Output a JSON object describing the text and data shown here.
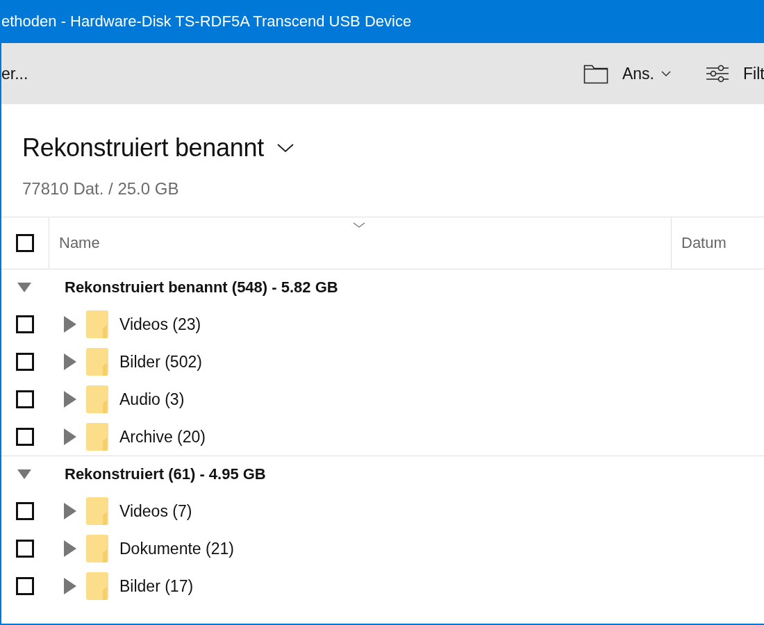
{
  "window": {
    "title": "ethoden - Hardware-Disk TS-RDF5A Transcend USB Device"
  },
  "toolbar": {
    "left_text": "er...",
    "view_button": "Ans.",
    "filter_button": "Filt"
  },
  "heading": {
    "title": "Rekonstruiert benannt",
    "summary": "77810 Dat. / 25.0 GB"
  },
  "table": {
    "select_all_checked": false,
    "columns": [
      "Name",
      "Datum"
    ],
    "groups": [
      {
        "label": "Rekonstruiert benannt (548) - 5.82 GB",
        "expanded": true,
        "rows": [
          {
            "name": "Videos (23)",
            "checked": false,
            "expanded": false
          },
          {
            "name": "Bilder (502)",
            "checked": false,
            "expanded": false
          },
          {
            "name": "Audio (3)",
            "checked": false,
            "expanded": false
          },
          {
            "name": "Archive (20)",
            "checked": false,
            "expanded": false
          }
        ]
      },
      {
        "label": "Rekonstruiert (61) - 4.95 GB",
        "expanded": true,
        "rows": [
          {
            "name": "Videos (7)",
            "checked": false,
            "expanded": false
          },
          {
            "name": "Dokumente (21)",
            "checked": false,
            "expanded": false
          },
          {
            "name": "Bilder (17)",
            "checked": false,
            "expanded": false
          }
        ]
      }
    ]
  }
}
